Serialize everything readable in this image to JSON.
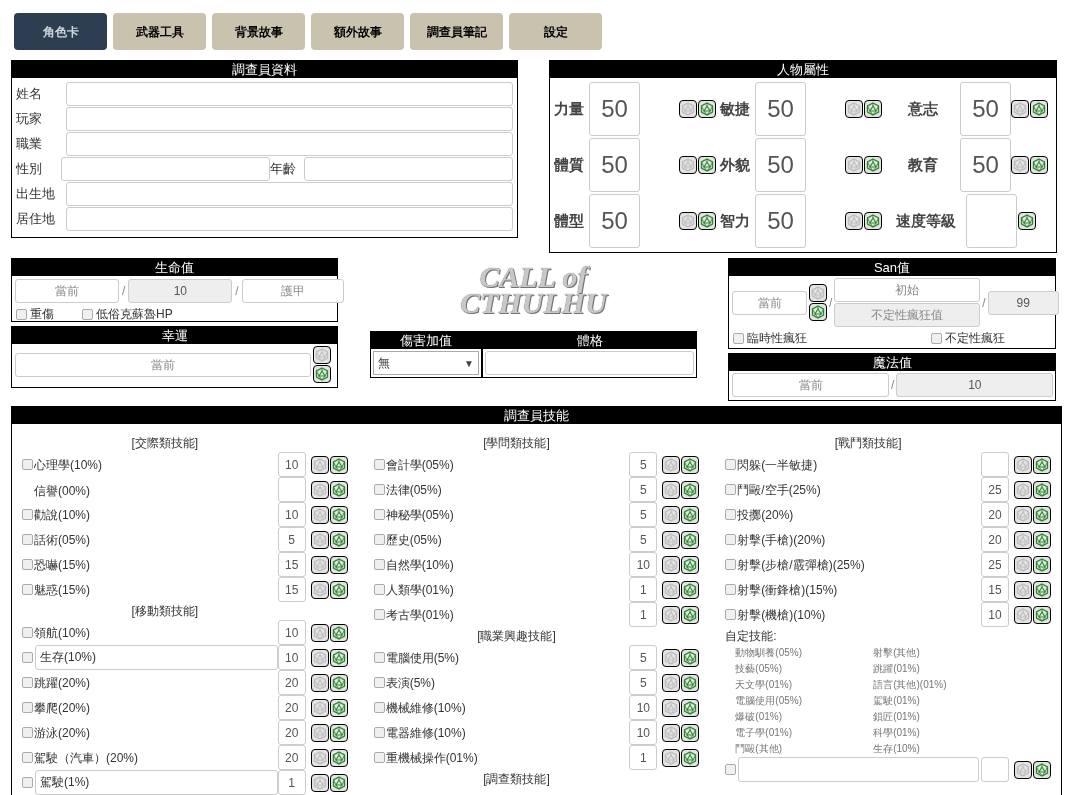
{
  "tabs": [
    {
      "label": "角色卡",
      "selected": true
    },
    {
      "label": "武器工具",
      "selected": false
    },
    {
      "label": "背景故事",
      "selected": false
    },
    {
      "label": "額外故事",
      "selected": false
    },
    {
      "label": "調查員筆記",
      "selected": false
    },
    {
      "label": "設定",
      "selected": false
    }
  ],
  "investigator": {
    "title": "調查員資料",
    "rows": [
      {
        "label": "姓名"
      },
      {
        "label": "玩家"
      },
      {
        "label": "職業"
      },
      {
        "label": "性別",
        "extra_label": "年齡"
      },
      {
        "label": "出生地"
      },
      {
        "label": "居住地"
      }
    ]
  },
  "attributes": {
    "title": "人物屬性",
    "items": [
      {
        "label": "力量",
        "value": "50",
        "kind": "stat"
      },
      {
        "label": "敏捷",
        "value": "50",
        "kind": "stat"
      },
      {
        "label": "意志",
        "value": "50",
        "kind": "stat"
      },
      {
        "label": "體質",
        "value": "50",
        "kind": "stat"
      },
      {
        "label": "外貌",
        "value": "50",
        "kind": "stat"
      },
      {
        "label": "教育",
        "value": "50",
        "kind": "stat"
      },
      {
        "label": "體型",
        "value": "50",
        "kind": "stat"
      },
      {
        "label": "智力",
        "value": "50",
        "kind": "stat"
      },
      {
        "label": "速度等級",
        "kind": "derived"
      }
    ]
  },
  "hp": {
    "title": "生命值",
    "fields": [
      {
        "placeholder": "當前",
        "disabled": false
      },
      {
        "value": "10",
        "disabled": true
      },
      {
        "placeholder": "護甲",
        "disabled": false
      }
    ],
    "separators": [
      "/",
      "/"
    ],
    "checks": [
      {
        "label": "重傷",
        "checked": false
      },
      {
        "label": "低俗克蘇魯HP",
        "checked": false
      }
    ]
  },
  "luck": {
    "title": "幸運",
    "field": {
      "placeholder": "當前",
      "disabled": false
    }
  },
  "logo": {
    "line1": "CALL of",
    "line2": "CTHULHU"
  },
  "damage": {
    "title": "傷害加值",
    "select": "無",
    "arrow": "▼",
    "build_title": "體格"
  },
  "san": {
    "title": "San值",
    "current": {
      "placeholder": "當前",
      "disabled": false
    },
    "start": {
      "placeholder": "初始",
      "disabled": false
    },
    "indef": {
      "placeholder": "不定性瘋狂值",
      "disabled": true
    },
    "max": {
      "value": "99",
      "disabled": true
    },
    "separators": [
      "/",
      "/"
    ],
    "checks": [
      {
        "label": "臨時性瘋狂",
        "checked": false
      },
      {
        "label": "不定性瘋狂",
        "checked": false
      }
    ]
  },
  "mp": {
    "title": "魔法值",
    "current": {
      "placeholder": "當前",
      "disabled": false
    },
    "separator": "/",
    "max": {
      "value": "10",
      "disabled": true
    }
  },
  "skills": {
    "title": "調查員技能",
    "columns": [
      {
        "groups": [
          {
            "title": "[交際類技能]",
            "rows": [
              {
                "kind": "plain",
                "name": "心理學(10%)",
                "value": "10",
                "checked": false
              },
              {
                "kind": "bare",
                "name": "信譽(00%)"
              },
              {
                "kind": "plain",
                "name": "勸說(10%)",
                "value": "10",
                "checked": false
              },
              {
                "kind": "plain",
                "name": "話術(05%)",
                "value": "5",
                "checked": false
              },
              {
                "kind": "plain",
                "name": "恐嚇(15%)",
                "value": "15",
                "checked": false
              },
              {
                "kind": "plain",
                "name": "魅惑(15%)",
                "value": "15",
                "checked": false
              }
            ]
          },
          {
            "title": "[移動類技能]",
            "rows": [
              {
                "kind": "plain",
                "name": "領航(10%)",
                "value": "10",
                "checked": false
              },
              {
                "kind": "editable",
                "name": "生存(10%)",
                "value": "10",
                "checked": false
              },
              {
                "kind": "plain",
                "name": "跳躍(20%)",
                "value": "20",
                "checked": false
              },
              {
                "kind": "plain",
                "name": "攀爬(20%)",
                "value": "20",
                "checked": false
              },
              {
                "kind": "plain",
                "name": "游泳(20%)",
                "value": "20",
                "checked": false
              },
              {
                "kind": "plain",
                "name": "駕駛（汽車）(20%)",
                "value": "20",
                "checked": false
              },
              {
                "kind": "editable",
                "name": "駕駛(1%)",
                "value": "1",
                "checked": false
              }
            ]
          }
        ]
      },
      {
        "groups": [
          {
            "title": "[學問類技能]",
            "rows": [
              {
                "kind": "plain",
                "name": "會計學(05%)",
                "value": "5",
                "checked": false
              },
              {
                "kind": "plain",
                "name": "法律(05%)",
                "value": "5",
                "checked": false
              },
              {
                "kind": "plain",
                "name": "神秘學(05%)",
                "value": "5",
                "checked": false
              },
              {
                "kind": "plain",
                "name": "歷史(05%)",
                "value": "5",
                "checked": false
              },
              {
                "kind": "plain",
                "name": "自然學(10%)",
                "value": "10",
                "checked": false
              },
              {
                "kind": "plain",
                "name": "人類學(01%)",
                "value": "1",
                "checked": false
              },
              {
                "kind": "plain",
                "name": "考古學(01%)",
                "value": "1",
                "checked": false
              }
            ]
          },
          {
            "title": "[職業興趣技能]",
            "rows": [
              {
                "kind": "plain",
                "name": "電腦使用(5%)",
                "value": "5",
                "checked": false
              },
              {
                "kind": "plain",
                "name": "表演(5%)",
                "value": "5",
                "checked": false
              },
              {
                "kind": "plain",
                "name": "機械維修(10%)",
                "value": "10",
                "checked": false
              },
              {
                "kind": "plain",
                "name": "電器維修(10%)",
                "value": "10",
                "checked": false
              },
              {
                "kind": "plain",
                "name": "重機械操作(01%)",
                "value": "1",
                "checked": false
              }
            ]
          },
          {
            "title": "[調查類技能]"
          }
        ]
      },
      {
        "groups": [
          {
            "title": "[戰鬥類技能]",
            "rows": [
              {
                "kind": "plain",
                "name": "閃躲(一半敏捷)",
                "checked": false
              },
              {
                "kind": "plain",
                "name": "鬥毆/空手(25%)",
                "value": "25",
                "checked": false
              },
              {
                "kind": "plain",
                "name": "投擲(20%)",
                "value": "20",
                "checked": false
              },
              {
                "kind": "plain",
                "name": "射擊(手槍)(20%)",
                "value": "20",
                "checked": false
              },
              {
                "kind": "plain",
                "name": "射擊(步槍/霰彈槍)(25%)",
                "value": "25",
                "checked": false
              },
              {
                "kind": "plain",
                "name": "射擊(衝鋒槍)(15%)",
                "value": "15",
                "checked": false
              },
              {
                "kind": "plain",
                "name": "射擊(機槍)(10%)",
                "value": "10",
                "checked": false
              }
            ]
          }
        ],
        "custom": {
          "label": "自定技能:",
          "hints": [
            "動物馴養(05%)",
            "射擊(其他)",
            "技藝(05%)",
            "跳躍(01%)",
            "天文學(01%)",
            "語言(其他)(01%)",
            "電腦使用(05%)",
            "駕駛(01%)",
            "爆破(01%)",
            "鎖匠(01%)",
            "電子學(01%)",
            "科學(01%)",
            "鬥毆(其他)",
            "生存(10%)"
          ],
          "rows": [
            {
              "checked": false
            }
          ]
        }
      }
    ]
  }
}
